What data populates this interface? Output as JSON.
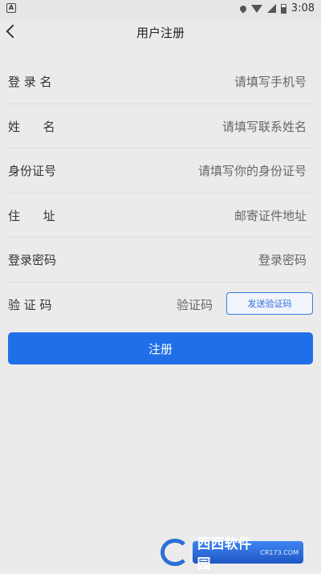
{
  "status_bar": {
    "notification_glyph": "A",
    "time": "3:08"
  },
  "header": {
    "title": "用户注册"
  },
  "form": {
    "fields": [
      {
        "label": "登 录 名",
        "placeholder": "请填写手机号"
      },
      {
        "label": "姓      名",
        "placeholder": "请填写联系姓名"
      },
      {
        "label": "身份证号",
        "placeholder": "请填写你的身份证号"
      },
      {
        "label": "住      址",
        "placeholder": "邮寄证件地址"
      },
      {
        "label": "登录密码",
        "placeholder": "登录密码"
      },
      {
        "label": "验 证 码",
        "placeholder": "验证码"
      }
    ],
    "send_code_label": "发送验证码",
    "submit_label": "注册"
  },
  "watermark": {
    "brand": "西西软件园",
    "sub": "CR173.COM"
  },
  "colors": {
    "accent": "#1e6fe8",
    "background": "#ebebeb"
  },
  "icons": [
    "back-arrow-icon",
    "location-icon",
    "wifi-icon",
    "signal-icon",
    "battery-icon"
  ]
}
